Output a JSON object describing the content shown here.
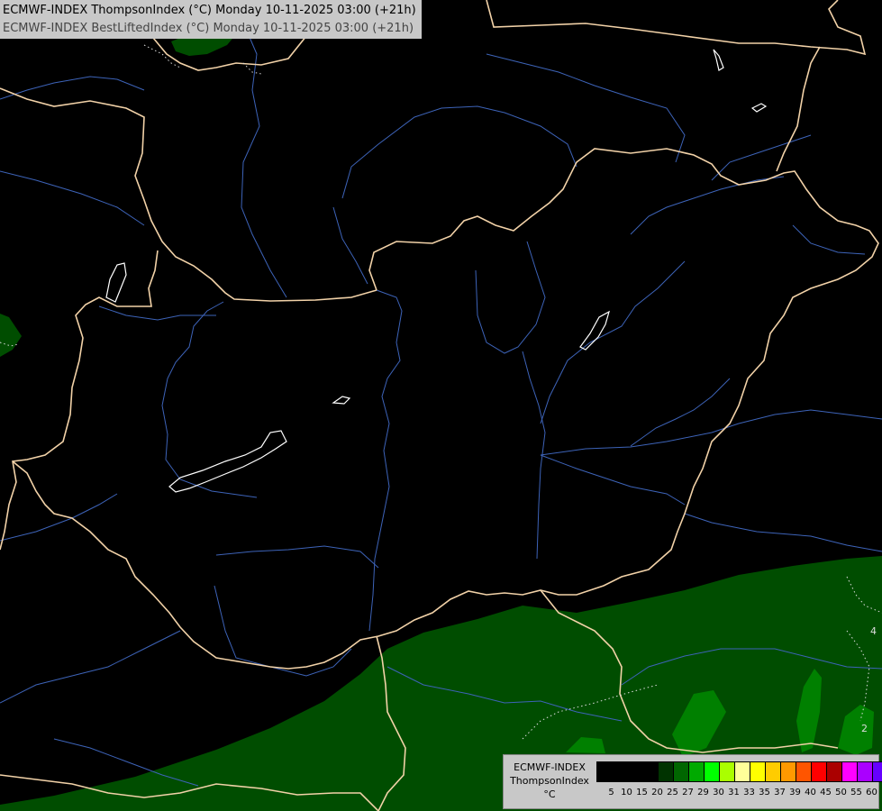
{
  "title": {
    "line1": "ECMWF-INDEX ThompsonIndex (°C) Monday 10-11-2025 03:00 (+21h)",
    "line2": "ECMWF-INDEX BestLiftedIndex (°C) Monday 10-11-2025 03:00 (+21h)"
  },
  "map": {
    "contour_label": "2",
    "contour_label_2": "4"
  },
  "legend": {
    "model": "ECMWF-INDEX",
    "parameter": "ThompsonIndex",
    "unit": "°C",
    "ticks": [
      "5",
      "10",
      "15",
      "20",
      "25",
      "27",
      "29",
      "30",
      "31",
      "33",
      "35",
      "37",
      "39",
      "40",
      "45",
      "50",
      "55",
      "60"
    ],
    "colors": [
      "#000000",
      "#000000",
      "#000000",
      "#000000",
      "#003300",
      "#006600",
      "#00aa00",
      "#00ff00",
      "#aaff00",
      "#ffff99",
      "#ffff00",
      "#ffcc00",
      "#ff9900",
      "#ff5500",
      "#ff0000",
      "#aa0000",
      "#ff00ff",
      "#aa00ff",
      "#6600ff",
      "#0000ff"
    ]
  }
}
